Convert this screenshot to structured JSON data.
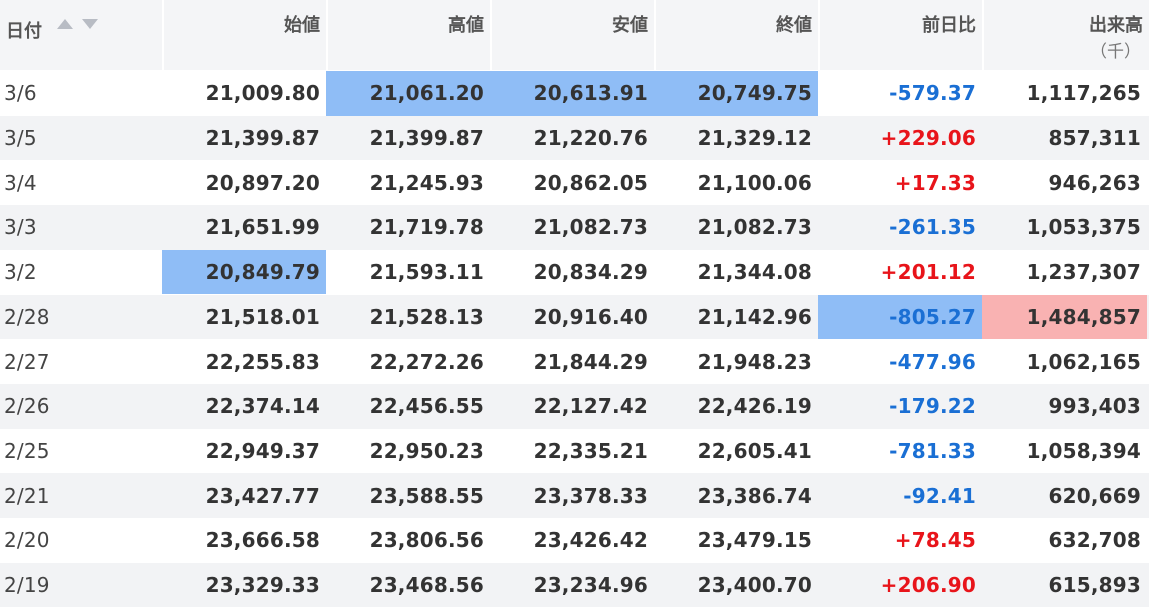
{
  "columns": {
    "date": "日付",
    "open": "始値",
    "high": "高値",
    "low": "安値",
    "close": "終値",
    "change": "前日比",
    "volume": "出来高",
    "volume_unit": "（千）"
  },
  "colors": {
    "header_bg": "#f4f5f7",
    "stripe_bg": "#f2f3f5",
    "highlight_blue": "#8fbdf6",
    "highlight_red": "#f9b2b2",
    "negative_text": "#1a6fd4",
    "positive_text": "#e8141a",
    "sort_arrow": "#b8bcc4"
  },
  "icons": {
    "sort_ascending": "triangle-up-icon",
    "sort_descending": "triangle-down-icon"
  },
  "rows": [
    {
      "date": "3/6",
      "open": "21,009.80",
      "high": "21,061.20",
      "low": "20,613.91",
      "close": "20,749.75",
      "change": "-579.37",
      "volume": "1,117,265",
      "highlight": {
        "high": "blue",
        "low": "blue",
        "close": "blue"
      }
    },
    {
      "date": "3/5",
      "open": "21,399.87",
      "high": "21,399.87",
      "low": "21,220.76",
      "close": "21,329.12",
      "change": "+229.06",
      "volume": "857,311",
      "highlight": {}
    },
    {
      "date": "3/4",
      "open": "20,897.20",
      "high": "21,245.93",
      "low": "20,862.05",
      "close": "21,100.06",
      "change": "+17.33",
      "volume": "946,263",
      "highlight": {}
    },
    {
      "date": "3/3",
      "open": "21,651.99",
      "high": "21,719.78",
      "low": "21,082.73",
      "close": "21,082.73",
      "change": "-261.35",
      "volume": "1,053,375",
      "highlight": {}
    },
    {
      "date": "3/2",
      "open": "20,849.79",
      "high": "21,593.11",
      "low": "20,834.29",
      "close": "21,344.08",
      "change": "+201.12",
      "volume": "1,237,307",
      "highlight": {
        "open": "blue"
      }
    },
    {
      "date": "2/28",
      "open": "21,518.01",
      "high": "21,528.13",
      "low": "20,916.40",
      "close": "21,142.96",
      "change": "-805.27",
      "volume": "1,484,857",
      "highlight": {
        "change": "blue",
        "volume": "red"
      }
    },
    {
      "date": "2/27",
      "open": "22,255.83",
      "high": "22,272.26",
      "low": "21,844.29",
      "close": "21,948.23",
      "change": "-477.96",
      "volume": "1,062,165",
      "highlight": {}
    },
    {
      "date": "2/26",
      "open": "22,374.14",
      "high": "22,456.55",
      "low": "22,127.42",
      "close": "22,426.19",
      "change": "-179.22",
      "volume": "993,403",
      "highlight": {}
    },
    {
      "date": "2/25",
      "open": "22,949.37",
      "high": "22,950.23",
      "low": "22,335.21",
      "close": "22,605.41",
      "change": "-781.33",
      "volume": "1,058,394",
      "highlight": {}
    },
    {
      "date": "2/21",
      "open": "23,427.77",
      "high": "23,588.55",
      "low": "23,378.33",
      "close": "23,386.74",
      "change": "-92.41",
      "volume": "620,669",
      "highlight": {}
    },
    {
      "date": "2/20",
      "open": "23,666.58",
      "high": "23,806.56",
      "low": "23,426.42",
      "close": "23,479.15",
      "change": "+78.45",
      "volume": "632,708",
      "highlight": {}
    },
    {
      "date": "2/19",
      "open": "23,329.33",
      "high": "23,468.56",
      "low": "23,234.96",
      "close": "23,400.70",
      "change": "+206.90",
      "volume": "615,893",
      "highlight": {}
    }
  ]
}
